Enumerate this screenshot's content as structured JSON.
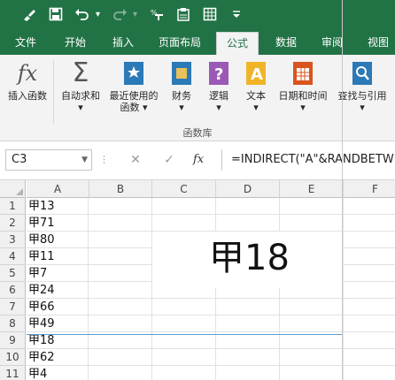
{
  "qat": {
    "icons": [
      "brush-icon",
      "save-icon",
      "undo-icon",
      "redo-icon",
      "format-painter-icon",
      "clipboard-icon",
      "table-icon",
      "customize-icon"
    ]
  },
  "tabs": [
    {
      "label": "文件"
    },
    {
      "label": "开始"
    },
    {
      "label": "插入"
    },
    {
      "label": "页面布局"
    },
    {
      "label": "公式"
    },
    {
      "label": "数据"
    },
    {
      "label": "审阅"
    },
    {
      "label": "视图"
    }
  ],
  "active_tab": "公式",
  "ribbon": {
    "insert_function": "插入函数",
    "autosum": "自动求和",
    "recent_line1": "最近使用的",
    "recent_line2": "函数",
    "financial": "财务",
    "logical": "逻辑",
    "text": "文本",
    "datetime": "日期和时间",
    "lookup": "查找与引用",
    "group_label": "函数库",
    "fx_glyph": "fx",
    "sigma_glyph": "Σ",
    "logical_glyph": "?",
    "text_glyph": "A"
  },
  "formula_bar": {
    "name_box": "C3",
    "fx_label": "fx",
    "cancel_glyph": "✕",
    "enter_glyph": "✓",
    "formula": "=INDIRECT(\"A\"&RANDBETW"
  },
  "grid": {
    "columns": [
      "A",
      "B",
      "C",
      "D",
      "E",
      "F"
    ],
    "rows": [
      {
        "num": "1",
        "a": "甲13"
      },
      {
        "num": "2",
        "a": "甲71"
      },
      {
        "num": "3",
        "a": "甲80"
      },
      {
        "num": "4",
        "a": "甲11"
      },
      {
        "num": "5",
        "a": "甲7"
      },
      {
        "num": "6",
        "a": "甲24"
      },
      {
        "num": "7",
        "a": "甲66"
      },
      {
        "num": "8",
        "a": "甲49"
      },
      {
        "num": "9",
        "a": "甲18"
      },
      {
        "num": "10",
        "a": "甲62"
      },
      {
        "num": "11",
        "a": "甲4"
      }
    ],
    "big_result": "甲18"
  },
  "colors": {
    "accent": "#217346",
    "ribbon_bg": "#f3f3f3",
    "selection": "#5b9bd5"
  }
}
